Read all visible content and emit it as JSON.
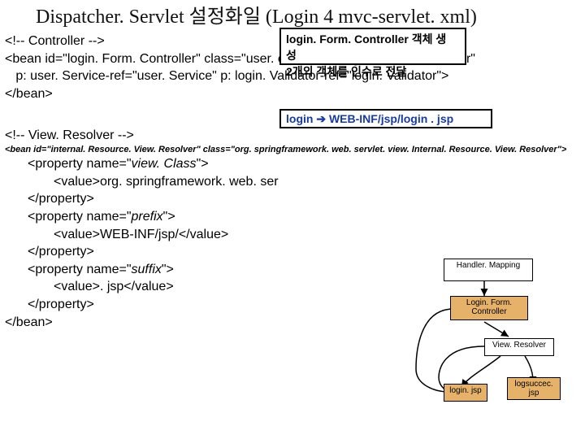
{
  "title": "Dispatcher. Servlet 설정화일 (Login 4 mvc-servlet. xml)",
  "callout1": {
    "line1": "login. Form. Controller 객체 생",
    "line2": "성",
    "line3": "2개의 객체를 인수로 전달"
  },
  "controller": {
    "comment": "<!-- Controller -->",
    "bean_open": "<bean id=\"login. Form. Controller\" class=\"user. controller. Login. Form. Controller\"",
    "props": "   p: user. Service-ref=\"user. Service\" p: login. Validator-ref=\"login. Validator\">",
    "bean_close": "</bean>"
  },
  "callout2": "login ➔ WEB-INF/jsp/login . jsp",
  "view": {
    "comment": "<!-- View. Resolver -->",
    "bean_line": "<bean id=\"internal. Resource. View. Resolver\" class=\"org. springframework. web. servlet. view. Internal. Resource. View. Resolver\">",
    "prop1_open": "<property name=\"view. Class\">",
    "prop1_val": "<value>org. springframework. web. ser",
    "prop1_close": "</property>",
    "prop2_open": "<property name=\"prefix\">",
    "prop2_val": "<value>WEB-INF/jsp/</value>",
    "prop2_close": "</property>",
    "prop3_open": "<property name=\"suffix\">",
    "prop3_val": "<value>. jsp</value>",
    "prop3_close": "</property>",
    "bean_close": "</bean>"
  },
  "diagram": {
    "handler_mapping": "Handler. Mapping",
    "login_form_controller": "Login. Form. Controller",
    "view_resolver": "View. Resolver",
    "login_jsp": "login. jsp",
    "logsuccess_jsp": "logsuccec. jsp"
  }
}
